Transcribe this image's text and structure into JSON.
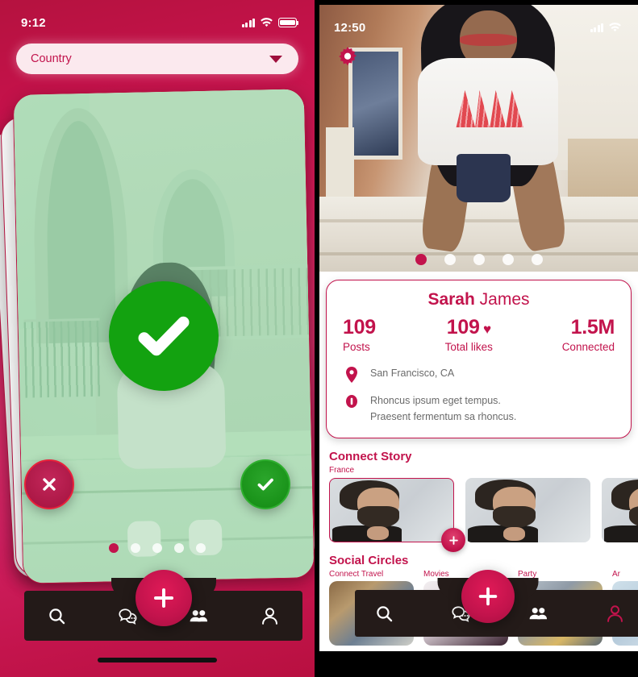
{
  "left_phone": {
    "status": {
      "time": "9:12",
      "signal_icon": "cellular-bars-icon",
      "wifi_icon": "wifi-icon",
      "battery_icon": "battery-full-icon"
    },
    "country_select": {
      "label": "Country",
      "caret_icon": "chevron-down-icon"
    },
    "swipe_card": {
      "overlay_icon": "check-circle-icon",
      "overlay_color": "#13a210",
      "reject_label": "×",
      "accept_label": "✓",
      "reject_icon": "close-icon",
      "accept_icon": "check-icon",
      "dots_total": 5,
      "dots_active": 1
    },
    "bottom_nav": {
      "items": [
        {
          "name": "search",
          "icon": "search-icon",
          "active": false
        },
        {
          "name": "messages",
          "icon": "chat-bubbles-icon",
          "active": false
        },
        {
          "name": "add",
          "icon": "plus-icon",
          "active": true
        },
        {
          "name": "people",
          "icon": "people-group-icon",
          "active": false
        },
        {
          "name": "profile",
          "icon": "person-icon",
          "active": false
        }
      ]
    }
  },
  "right_phone": {
    "status": {
      "time": "12:50",
      "signal_icon": "cellular-bars-icon",
      "wifi_icon": "wifi-icon"
    },
    "settings_icon": "gear-icon",
    "hero": {
      "dots_total": 5,
      "dots_active": 1
    },
    "profile": {
      "first_name": "Sarah",
      "last_name": "James",
      "stats": [
        {
          "value": "109",
          "label": "Posts",
          "heart": false
        },
        {
          "value": "109",
          "label": "Total likes",
          "heart": true
        },
        {
          "value": "1.5M",
          "label": "Connected",
          "heart": false
        }
      ],
      "location_icon": "location-pin-icon",
      "location": "San Francisco, CA",
      "info_icon": "info-circle-icon",
      "bio_line1": "Rhoncus ipsum eget tempus.",
      "bio_line2": "Praesent fermentum sa  rhoncus."
    },
    "connect_story": {
      "title": "Connect Story",
      "add_icon": "plus-icon",
      "items": [
        {
          "caption": "France",
          "selected": true
        },
        {
          "caption": "",
          "selected": false
        },
        {
          "caption": "",
          "selected": false
        }
      ]
    },
    "social_circles": {
      "title": "Social Circles",
      "items": [
        {
          "caption": "Connect Travel"
        },
        {
          "caption": "Movies"
        },
        {
          "caption": "Party"
        },
        {
          "caption": "Ar"
        }
      ]
    },
    "bottom_nav": {
      "items": [
        {
          "name": "search",
          "icon": "search-icon",
          "active": false
        },
        {
          "name": "messages",
          "icon": "chat-bubbles-icon",
          "active": false
        },
        {
          "name": "add",
          "icon": "plus-icon",
          "active": true
        },
        {
          "name": "people",
          "icon": "people-group-icon",
          "active": false
        },
        {
          "name": "profile",
          "icon": "person-icon",
          "active": true
        }
      ]
    }
  },
  "colors": {
    "brand": "#c2134c",
    "brand_dark": "#a50f3f",
    "accept_green": "#13a210",
    "nav_dark": "#231a18"
  }
}
